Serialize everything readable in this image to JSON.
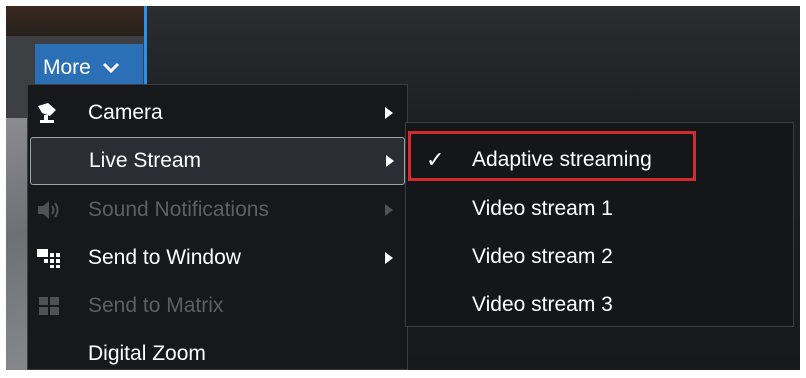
{
  "toolbar": {
    "more_label": "More",
    "more_icon": "chevron-down-icon"
  },
  "menu": {
    "items": [
      {
        "label": "Camera",
        "icon": "camera-icon",
        "enabled": true,
        "has_submenu": true
      },
      {
        "label": "Live Stream",
        "icon": "",
        "enabled": true,
        "has_submenu": true,
        "highlighted": true
      },
      {
        "label": "Sound Notifications",
        "icon": "speaker-icon",
        "enabled": false,
        "has_submenu": true
      },
      {
        "label": "Send to Window",
        "icon": "send-to-window-icon",
        "enabled": true,
        "has_submenu": true
      },
      {
        "label": "Send to Matrix",
        "icon": "matrix-grid-icon",
        "enabled": false,
        "has_submenu": false
      },
      {
        "label": "Digital Zoom",
        "icon": "",
        "enabled": true,
        "has_submenu": false
      }
    ]
  },
  "submenu": {
    "check_mark": "✓",
    "items": [
      {
        "label": "Adaptive streaming",
        "checked": true
      },
      {
        "label": "Video stream 1",
        "checked": false
      },
      {
        "label": "Video stream 2",
        "checked": false
      },
      {
        "label": "Video stream 3",
        "checked": false
      }
    ]
  },
  "colors": {
    "accent": "#2b6fb6",
    "highlight_border": "#d42c2c",
    "menu_bg": "#16181b",
    "disabled_text": "#5c5f64"
  }
}
